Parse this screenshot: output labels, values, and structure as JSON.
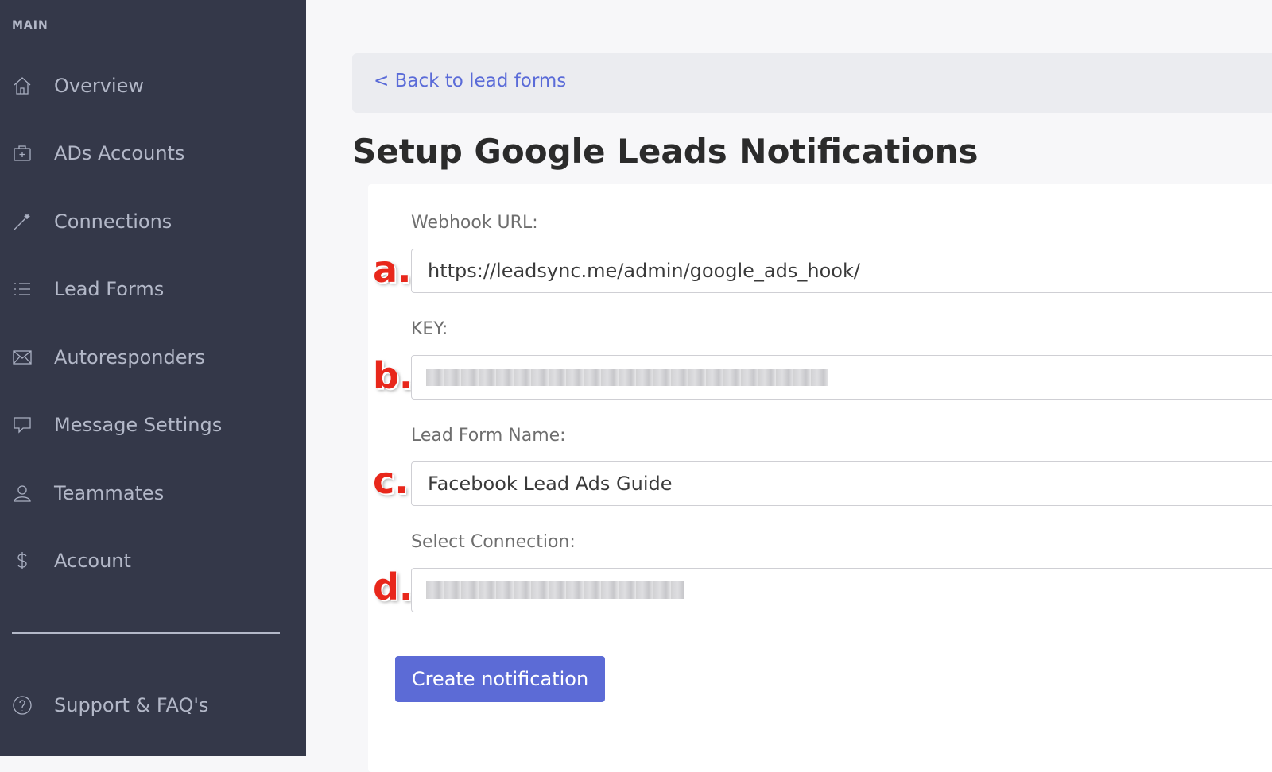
{
  "sidebar": {
    "section_label": "MAIN",
    "items": [
      {
        "label": "Overview",
        "icon": "home-icon"
      },
      {
        "label": "ADs Accounts",
        "icon": "briefcase-icon"
      },
      {
        "label": "Connections",
        "icon": "magic-wand-icon"
      },
      {
        "label": "Lead Forms",
        "icon": "list-icon"
      },
      {
        "label": "Autoresponders",
        "icon": "envelope-icon"
      },
      {
        "label": "Message Settings",
        "icon": "chat-icon"
      },
      {
        "label": "Teammates",
        "icon": "user-icon"
      },
      {
        "label": "Account",
        "icon": "dollar-icon"
      }
    ],
    "support": {
      "label": "Support & FAQ's",
      "icon": "question-circle-icon"
    }
  },
  "main": {
    "back_link": "< Back to lead forms",
    "title": "Setup Google Leads Notifications",
    "form": {
      "webhook": {
        "label": "Webhook URL:",
        "value": "https://leadsync.me/admin/google_ads_hook/",
        "marker": "a."
      },
      "key": {
        "label": "KEY:",
        "marker": "b."
      },
      "lead_form_name": {
        "label": "Lead Form Name:",
        "value": "Facebook Lead Ads Guide",
        "marker": "c."
      },
      "connection": {
        "label": "Select Connection:",
        "marker": "d."
      },
      "submit_label": "Create notification"
    }
  },
  "colors": {
    "sidebar_bg": "#343849",
    "accent": "#5c6bd6",
    "link": "#5a6bd8",
    "marker": "#e8271b"
  }
}
